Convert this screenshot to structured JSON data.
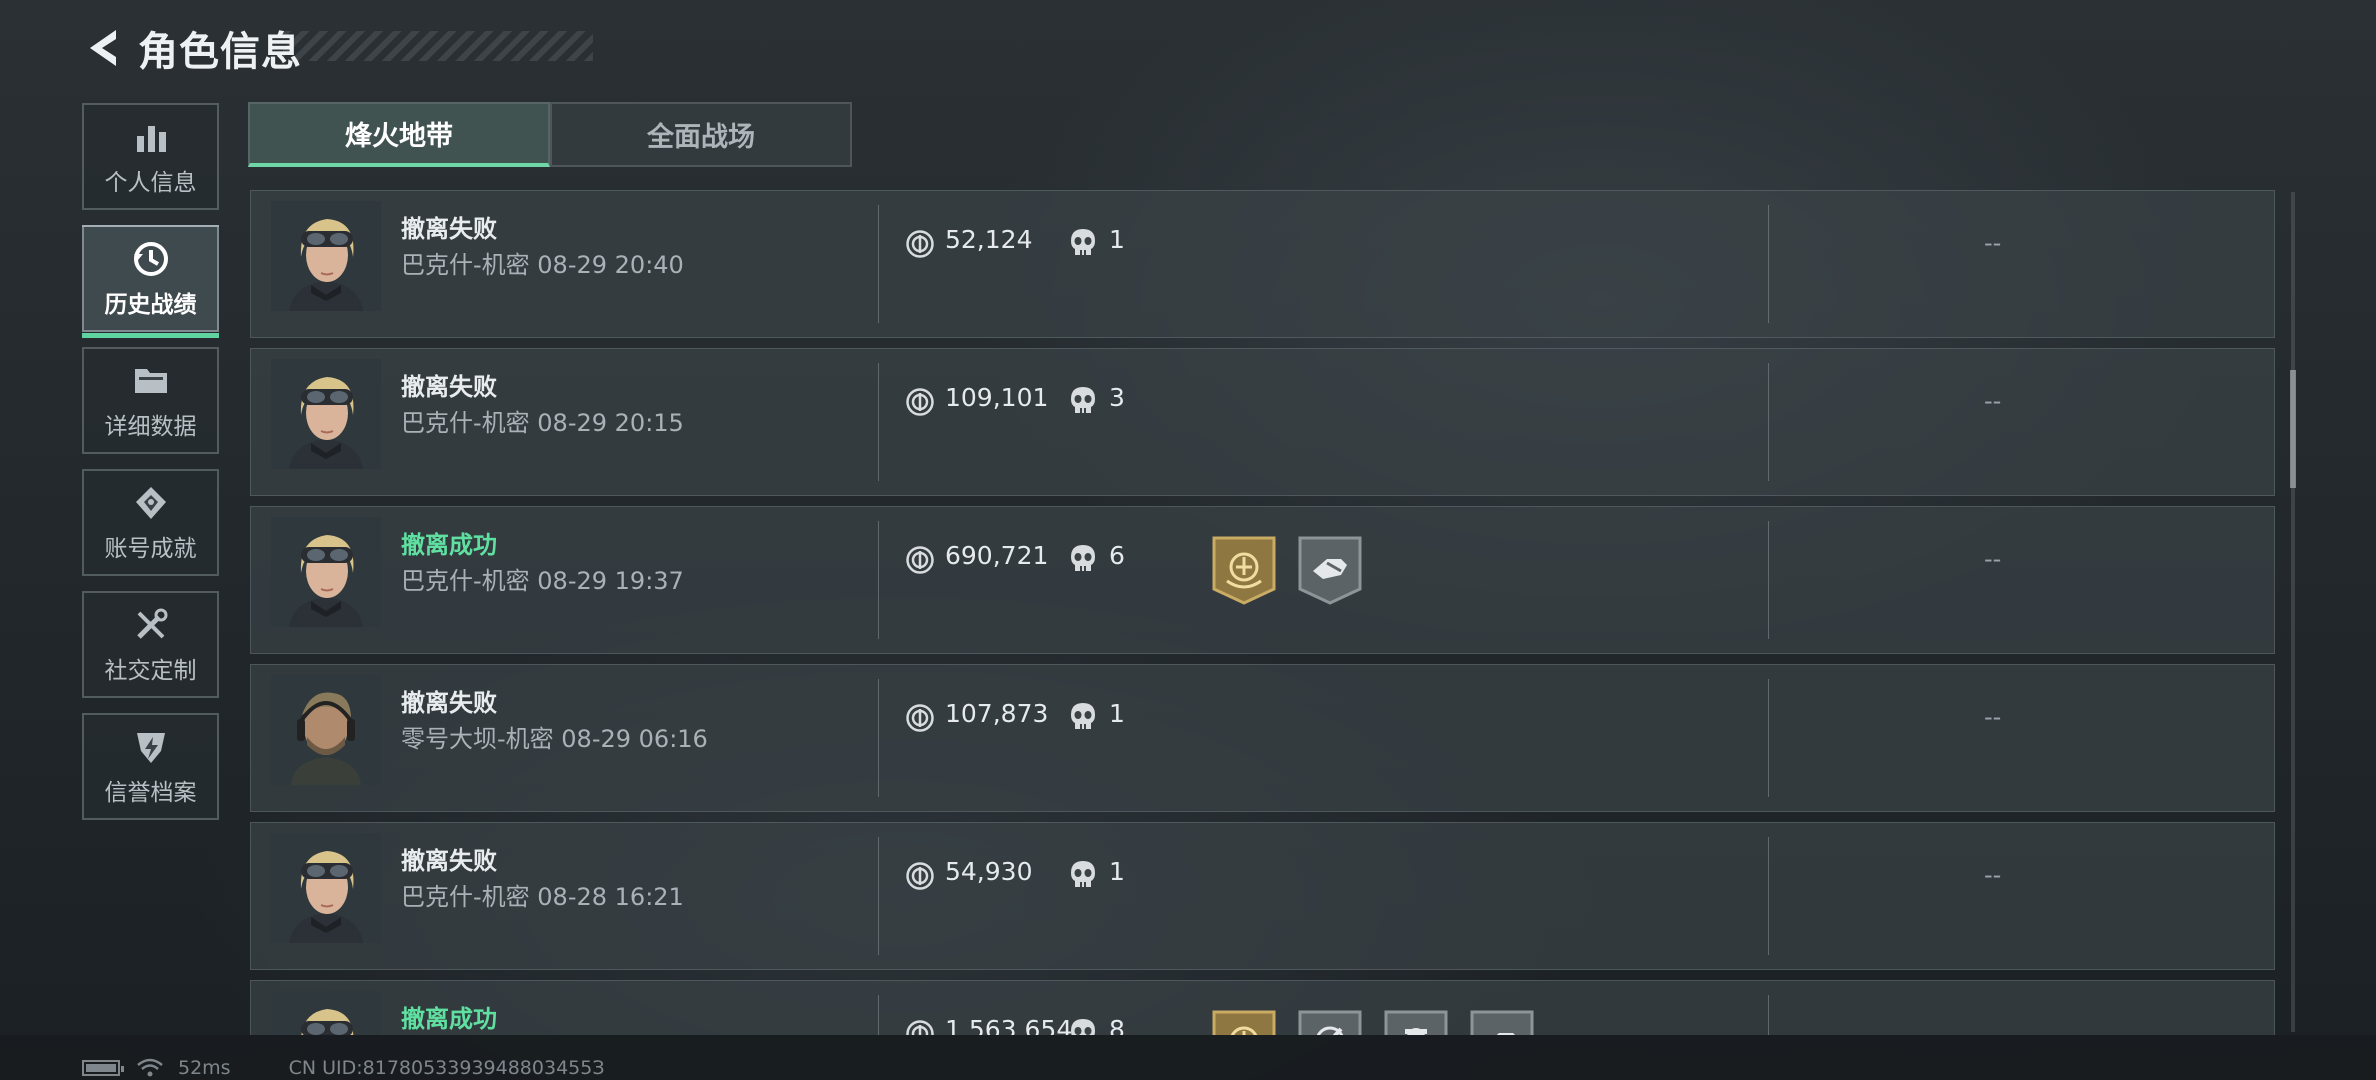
{
  "header": {
    "title": "角色信息"
  },
  "sidebar": {
    "items": [
      {
        "label": "个人信息",
        "icon": "bar-chart-icon",
        "active": false
      },
      {
        "label": "历史战绩",
        "icon": "clock-history-icon",
        "active": true
      },
      {
        "label": "详细数据",
        "icon": "folder-icon",
        "active": false
      },
      {
        "label": "账号成就",
        "icon": "achievement-diamond-icon",
        "active": false
      },
      {
        "label": "社交定制",
        "icon": "tools-icon",
        "active": false
      },
      {
        "label": "信誉档案",
        "icon": "shield-bolt-icon",
        "active": false
      }
    ]
  },
  "tabs": [
    {
      "label": "烽火地带",
      "active": true
    },
    {
      "label": "全面战场",
      "active": false
    }
  ],
  "matches": [
    {
      "status": "撤离失败",
      "success": false,
      "info": "巴克什-机密 08-29 20:40",
      "value": "52,124",
      "kills": "1",
      "extra": "--",
      "avatar": "female-operator-goggles",
      "badges": []
    },
    {
      "status": "撤离失败",
      "success": false,
      "info": "巴克什-机密 08-29 20:15",
      "value": "109,101",
      "kills": "3",
      "extra": "--",
      "avatar": "female-operator-goggles",
      "badges": []
    },
    {
      "status": "撤离成功",
      "success": true,
      "info": "巴克什-机密 08-29 19:37",
      "value": "690,721",
      "kills": "6",
      "extra": "--",
      "avatar": "female-operator-goggles",
      "badges": [
        "gold-emblem-badge",
        "grey-fist-badge"
      ]
    },
    {
      "status": "撤离失败",
      "success": false,
      "info": "零号大坝-机密 08-29 06:16",
      "value": "107,873",
      "kills": "1",
      "extra": "--",
      "avatar": "male-operator-headset",
      "badges": []
    },
    {
      "status": "撤离失败",
      "success": false,
      "info": "巴克什-机密 08-28 16:21",
      "value": "54,930",
      "kills": "1",
      "extra": "--",
      "avatar": "female-operator-goggles",
      "badges": []
    },
    {
      "status": "撤离成功",
      "success": true,
      "info": "",
      "value": "1,563,654",
      "kills": "8",
      "extra": "",
      "avatar": "female-operator-goggles",
      "badges": [
        "gold-emblem-badge",
        "grey-crosshair-badge",
        "grey-soldier-badge",
        "grey-fist-badge"
      ]
    }
  ],
  "statusbar": {
    "ping": "52ms",
    "uid": "CN UID:8178053393948803455З"
  },
  "colors": {
    "success": "#5fe0a0",
    "tab_active_underline": "#6fd6a8",
    "badge_gold": "#a88a4a"
  }
}
